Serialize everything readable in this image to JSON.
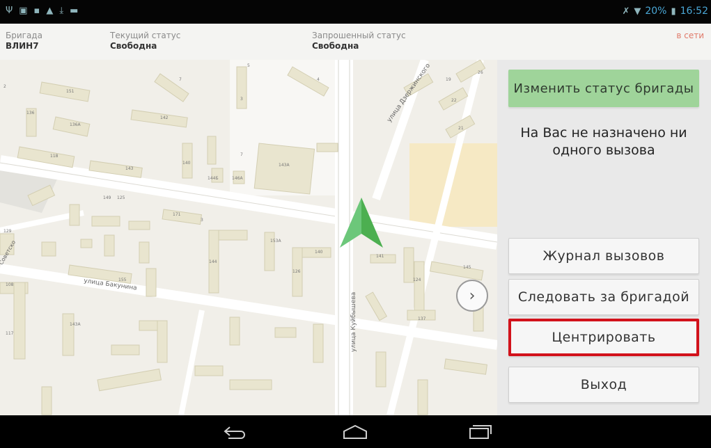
{
  "statusbar": {
    "left_icons": [
      "usb-icon",
      "screenshot-icon",
      "notification-icon",
      "warning-icon",
      "download-icon",
      "chat-icon"
    ],
    "battery_pct": "20%",
    "clock": "16:52"
  },
  "info": {
    "brigade_label": "Бригада",
    "brigade_value": "ВЛИН7",
    "current_status_label": "Текущий статус",
    "current_status_value": "Свободна",
    "requested_status_label": "Запрошенный статус",
    "requested_status_value": "Свободна",
    "online": "в сети"
  },
  "map": {
    "street_labels": [
      "улица Бакунина",
      "улица Куйбышева",
      "улица Дзержинского",
      "Советско"
    ],
    "building_numbers": [
      "5",
      "7",
      "3",
      "4",
      "2",
      "151",
      "136",
      "136А",
      "118",
      "143",
      "142",
      "7",
      "140",
      "143А",
      "144Б",
      "146А",
      "149",
      "125",
      "171",
      "3",
      "153А",
      "140",
      "141",
      "144",
      "126",
      "145",
      "124",
      "155",
      "129",
      "108",
      "117",
      "143А",
      "137",
      "22",
      "21",
      "26",
      "19"
    ],
    "accent_color": "#4caf50"
  },
  "panel": {
    "change_status": "Изменить статус бригады",
    "no_calls": "На Вас не назначено ни одного вызова",
    "journal": "Журнал вызовов",
    "follow": "Следовать за бригадой",
    "center": "Центрировать",
    "exit": "Выход"
  },
  "navbar": {
    "back": "back-icon",
    "home": "home-icon",
    "recents": "recent-apps-icon"
  },
  "colors": {
    "status_button": "#9fd49a",
    "highlight_border": "#d2121b",
    "online_text": "#e07a6a"
  }
}
